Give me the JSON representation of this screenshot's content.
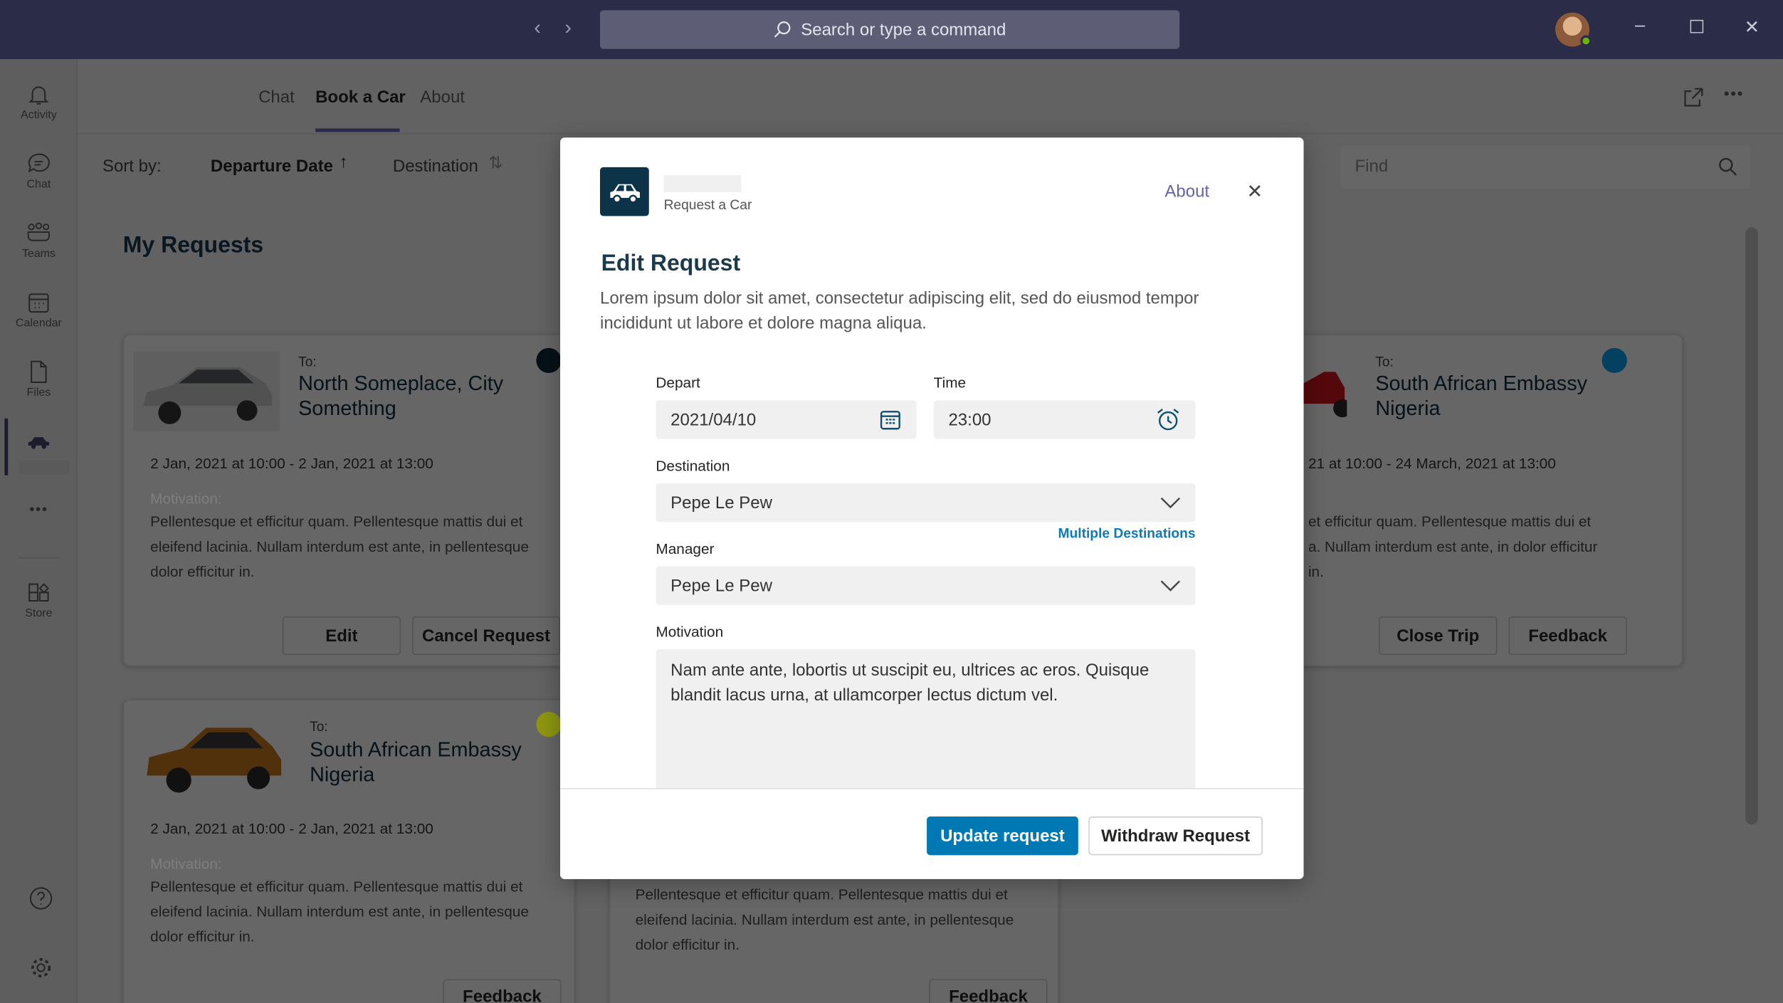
{
  "titlebar": {
    "search_placeholder": "Search or type a command",
    "back": "‹",
    "forward": "›",
    "minimize": "–",
    "maximize": "☐",
    "close": "✕"
  },
  "rail": {
    "items": [
      {
        "label": "Activity",
        "icon": "bell-icon"
      },
      {
        "label": "Chat",
        "icon": "chat-icon"
      },
      {
        "label": "Teams",
        "icon": "teams-icon"
      },
      {
        "label": "Calendar",
        "icon": "calendar-icon"
      },
      {
        "label": "Files",
        "icon": "file-icon"
      },
      {
        "label": "",
        "icon": "car-icon"
      },
      {
        "label": "",
        "icon": "more-icon"
      },
      {
        "label": "Store",
        "icon": "store-icon"
      }
    ],
    "more": "•••"
  },
  "header": {
    "tabs": [
      {
        "label": "Chat"
      },
      {
        "label": "Book a Car",
        "active": true
      },
      {
        "label": "About"
      }
    ]
  },
  "sortbar": {
    "label": "Sort by:",
    "options": [
      {
        "label": "Departure Date",
        "arrow": "↑"
      },
      {
        "label": "Destination",
        "arrow": "⇅"
      }
    ],
    "find_placeholder": "Find"
  },
  "main": {
    "title": "My Requests",
    "cards": [
      {
        "to": "To:",
        "destination": "North Someplace, City Something",
        "dates": "2 Jan, 2021 at 10:00 - 2 Jan, 2021 at 13:00",
        "motivation_label": "Motivation:",
        "motivation": "Pellentesque et efficitur quam. Pellentesque mattis dui et eleifend lacinia. Nullam interdum est ante, in pellentesque dolor efficitur in.",
        "status_color": "#0d2a3a",
        "buttons": [
          "Edit",
          "Cancel Request"
        ]
      },
      {
        "to": "To:",
        "destination": "South African Embassy Nigeria",
        "dates": "2 Jan, 2021 at 10:00 - 2 Jan, 2021 at 13:00",
        "motivation_label": "Motivation:",
        "motivation": "Pellentesque et efficitur quam. Pellentesque mattis dui et eleifend lacinia. Nullam interdum est ante, in pellentesque dolor efficitur in.",
        "status_color": "#b8c20e",
        "buttons": [
          "Feedback"
        ]
      },
      {
        "motivation": "Pellentesque et efficitur quam. Pellentesque mattis dui et eleifend lacinia. Nullam interdum est ante, in pellentesque dolor efficitur in.",
        "buttons": [
          "Feedback"
        ]
      },
      {
        "to": "To:",
        "destination": "South African Embassy Nigeria",
        "dates": "21 at 10:00 - 24 March, 2021 at 13:00",
        "motivation": "et efficitur quam. Pellentesque mattis dui et a. Nullam interdum est ante, in dolor efficitur in.",
        "status_color": "#0a6a9e",
        "buttons": [
          "Close Trip",
          "Feedback"
        ]
      }
    ]
  },
  "modal": {
    "app_name": "Request a Car",
    "about": "About",
    "close": "✕",
    "title": "Edit Request",
    "description": "Lorem ipsum dolor sit amet, consectetur adipiscing elit, sed do eiusmod tempor incididunt ut labore et dolore magna aliqua.",
    "depart": {
      "label": "Depart",
      "value": "2021/04/10"
    },
    "time": {
      "label": "Time",
      "value": "23:00"
    },
    "destination": {
      "label": "Destination",
      "value": "Pepe Le Pew",
      "link": "Multiple Destinations"
    },
    "manager": {
      "label": "Manager",
      "value": "Pepe Le Pew"
    },
    "motivation": {
      "label": "Motivation",
      "value": "Nam ante ante, lobortis ut suscipit eu, ultrices ac eros. Quisque blandit lacus urna, at ullamcorper lectus dictum vel."
    },
    "update_button": "Update request",
    "withdraw_button": "Withdraw Request",
    "accent": "#0078b4",
    "link_color": "#0f7ab8",
    "about_color": "#6264a7"
  }
}
